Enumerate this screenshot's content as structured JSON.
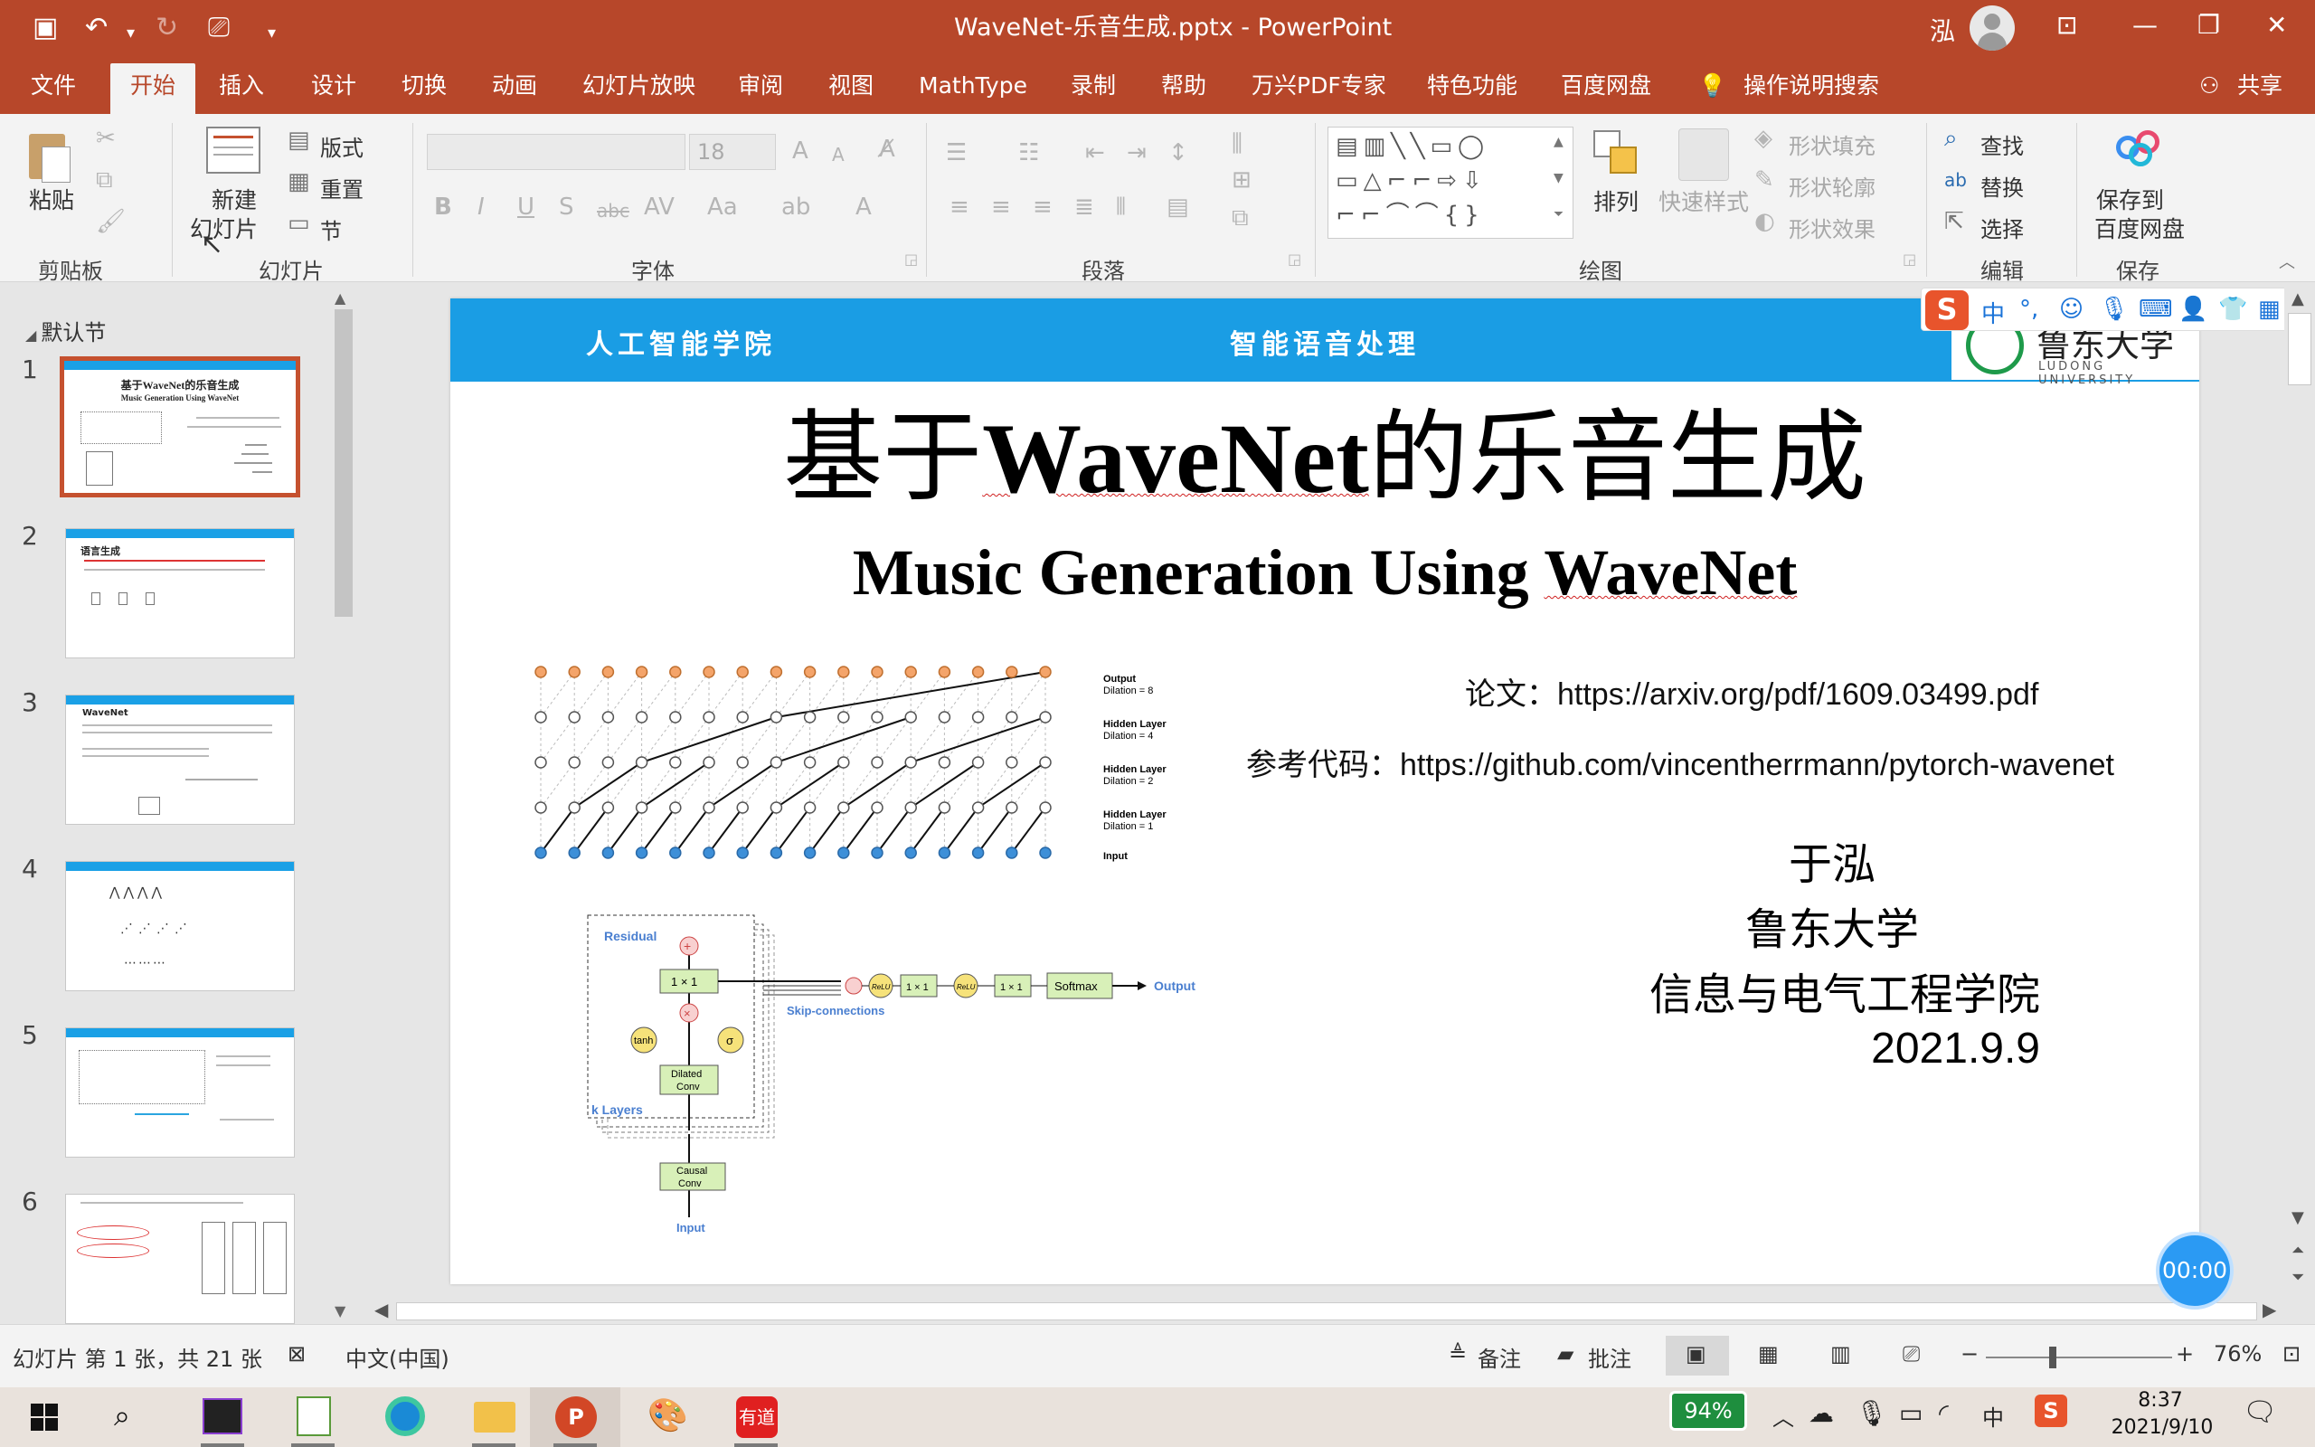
{
  "titlebar": {
    "document_title": "WaveNet-乐音生成.pptx  -  PowerPoint",
    "user_name": "泓"
  },
  "menu": {
    "tabs": [
      "文件",
      "开始",
      "插入",
      "设计",
      "切换",
      "动画",
      "幻灯片放映",
      "审阅",
      "视图",
      "MathType",
      "录制",
      "帮助",
      "万兴PDF专家",
      "特色功能",
      "百度网盘"
    ],
    "active_tab": "开始",
    "search": "操作说明搜索",
    "share": "共享"
  },
  "ribbon": {
    "clipboard": {
      "paste": "粘贴",
      "label": "剪贴板"
    },
    "slides": {
      "new_line1": "新建",
      "new_line2": "幻灯片",
      "layout": "版式",
      "reset": "重置",
      "section": "节",
      "label": "幻灯片"
    },
    "font": {
      "size": "18",
      "case": "Aa",
      "label": "字体"
    },
    "paragraph": {
      "label": "段落"
    },
    "drawing": {
      "arrange": "排列",
      "quick_styles": "快速样式",
      "shape_fill": "形状填充",
      "shape_outline": "形状轮廓",
      "shape_effects": "形状效果",
      "label": "绘图"
    },
    "editing": {
      "find": "查找",
      "replace": "替换",
      "select": "选择",
      "label": "编辑"
    },
    "save": {
      "line1": "保存到",
      "line2": "百度网盘",
      "label": "保存"
    }
  },
  "slide_panel": {
    "section_name": "默认节",
    "slide_numbers": [
      "1",
      "2",
      "3",
      "4",
      "5",
      "6"
    ],
    "thumb2_title": "语言生成",
    "thumb3_title": "WaveNet",
    "thumb1_title_cn": "基于WaveNet的乐音生成",
    "thumb1_title_en": "Music Generation Using WaveNet"
  },
  "slide": {
    "header_left": "人工智能学院",
    "header_center": "智能语音处理",
    "logo_text": "鲁东大学",
    "logo_sub": "LUDONG UNIVERSITY",
    "title_cn_pre": "基于",
    "title_cn_bold": "WaveNet",
    "title_cn_post": "的乐音生成",
    "title_en_pre": "Music Generation Using ",
    "title_en_u": "WaveNet",
    "paper_label": "论文：",
    "paper_url": "https://arxiv.org/pdf/1609.03499.pdf",
    "code_label": "参考代码：",
    "code_url": "https://github.com/vincentherrmann/pytorch-wavenet",
    "author": "于泓",
    "university": "鲁东大学",
    "school": "信息与电气工程学院",
    "date": "2021.9.9",
    "fig1_labels": {
      "output": "Output",
      "d8": "Dilation = 8",
      "h1": "Hidden Layer",
      "d4": "Dilation = 4",
      "h2": "Hidden Layer",
      "d2": "Dilation = 2",
      "h3": "Hidden Layer",
      "d1": "Dilation = 1",
      "input": "Input"
    },
    "fig2_labels": {
      "residual": "Residual",
      "one_by_one": "1 × 1",
      "tanh": "tanh",
      "sigma": "σ",
      "dilated_1": "Dilated",
      "dilated_2": "Conv",
      "k_layers": "k Layers",
      "causal_1": "Causal",
      "causal_2": "Conv",
      "input": "Input",
      "skip": "Skip-connections",
      "relu": "ReLU",
      "softmax": "Softmax",
      "output": "Output"
    }
  },
  "timer": "00:00",
  "status": {
    "slide_info": "幻灯片 第 1 张，共 21 张",
    "language": "中文(中国)",
    "notes": "备注",
    "comments": "批注",
    "zoom": "76%"
  },
  "taskbar": {
    "battery": "94%",
    "time": "8:37",
    "date": "2021/9/10",
    "ime": "中"
  },
  "ime_toolbar": {
    "logo": "S",
    "mode": "中",
    "punct": "°,"
  }
}
